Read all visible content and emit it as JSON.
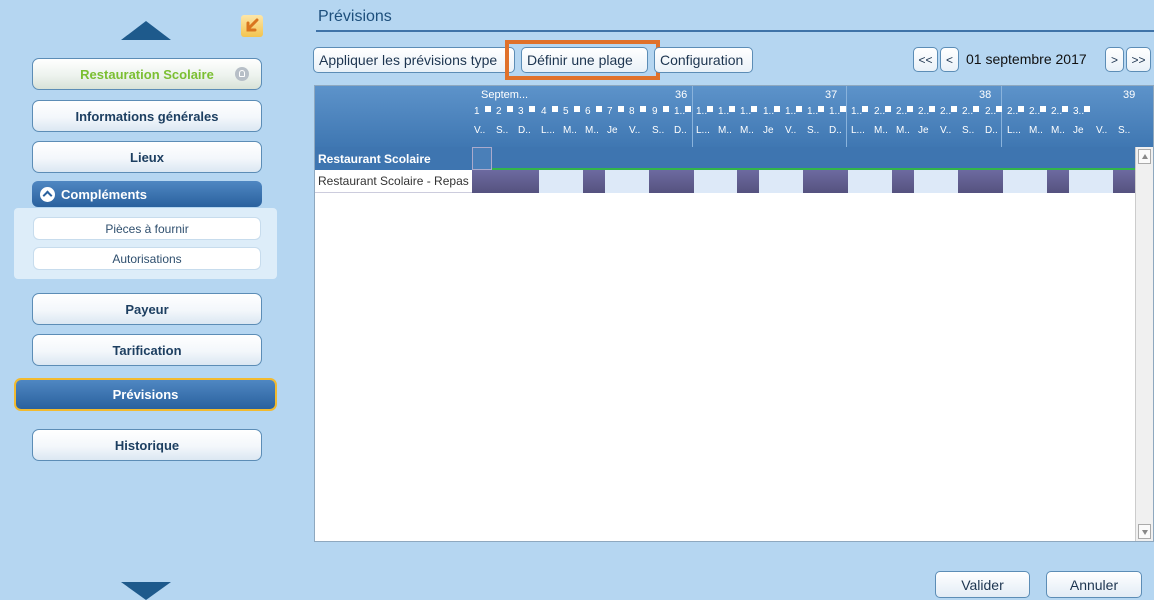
{
  "sidebar": {
    "items": [
      {
        "label": "Restauration Scolaire"
      },
      {
        "label": "Informations générales"
      },
      {
        "label": "Lieux"
      },
      {
        "label": "Compléments"
      },
      {
        "label": "Pièces à fournir"
      },
      {
        "label": "Autorisations"
      },
      {
        "label": "Payeur"
      },
      {
        "label": "Tarification"
      },
      {
        "label": "Prévisions"
      },
      {
        "label": "Historique"
      }
    ]
  },
  "main": {
    "title": "Prévisions",
    "toolbar": {
      "apply_label": "Appliquer les prévisions type",
      "range_label": "Définir une plage",
      "config_label": "Configuration"
    },
    "date_nav": {
      "first": "<<",
      "prev": "<",
      "date": "01 septembre 2017",
      "next": ">",
      "last": ">>"
    },
    "grid": {
      "month_label": "Septem...",
      "weeks": [
        "36",
        "37",
        "38",
        "39"
      ],
      "day_numbers": [
        "1",
        "2",
        "3",
        "4",
        "5",
        "6",
        "7",
        "8",
        "9",
        "1..",
        "1..",
        "1..",
        "1..",
        "1..",
        "1..",
        "1..",
        "1..",
        "1..",
        "2..",
        "2..",
        "2..",
        "2..",
        "2..",
        "2..",
        "2..",
        "2..",
        "2..",
        "3.."
      ],
      "day_names": [
        "V..",
        "S..",
        "D..",
        "L...",
        "M..",
        "M..",
        "Je",
        "V..",
        "S..",
        "D..",
        "L...",
        "M..",
        "M..",
        "Je",
        "V..",
        "S..",
        "D..",
        "L...",
        "M..",
        "M..",
        "Je",
        "V..",
        "S..",
        "D..",
        "L...",
        "M..",
        "M..",
        "Je",
        "V..",
        "S.."
      ],
      "group_row": "Restaurant Scolaire",
      "item_row": "Restaurant Scolaire - Repas"
    },
    "footer": {
      "validate_label": "Valider",
      "cancel_label": "Annuler"
    }
  },
  "colors": {
    "background": "#b5d6f1",
    "accent": "#2a619e",
    "highlight": "#e0712a",
    "bar": "#5f5c8d",
    "green": "#7bbf32"
  }
}
